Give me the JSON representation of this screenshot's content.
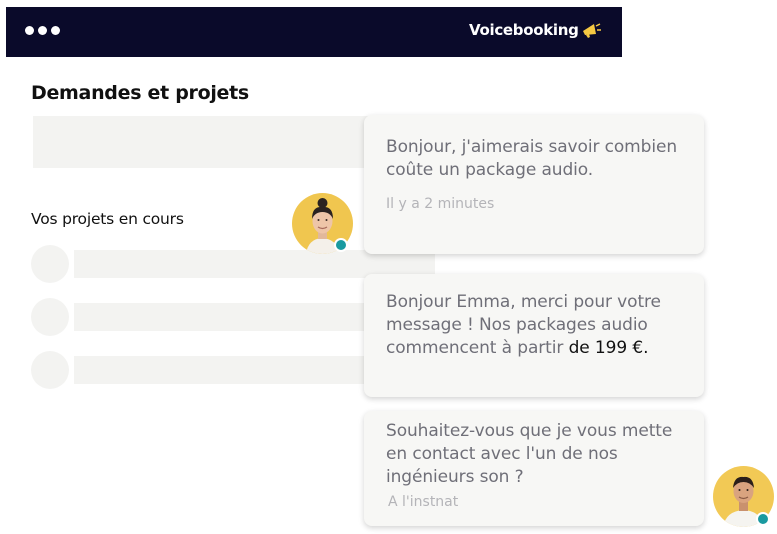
{
  "header": {
    "brand": "Voicebooking",
    "colors": {
      "bar": "#0a0a2a",
      "accent": "#f5c842"
    }
  },
  "page": {
    "title": "Demandes et projets",
    "section_title": "Vos projets en cours"
  },
  "chat": {
    "messages": [
      {
        "text": "Bonjour, j'aimerais savoir combien coûte un package audio.",
        "time": "Il y a 2 minutes"
      },
      {
        "text_before": "Bonjour Emma, merci pour votre message ! Nos packages audio commencent à partir ",
        "highlight": "de 199 €.",
        "time": ""
      },
      {
        "text": "Souhaitez-vous que je vous mette en contact avec l'un de nos ingénieurs son ?",
        "time": "A l'instnat"
      }
    ],
    "status_color": "#1a9aa0"
  }
}
